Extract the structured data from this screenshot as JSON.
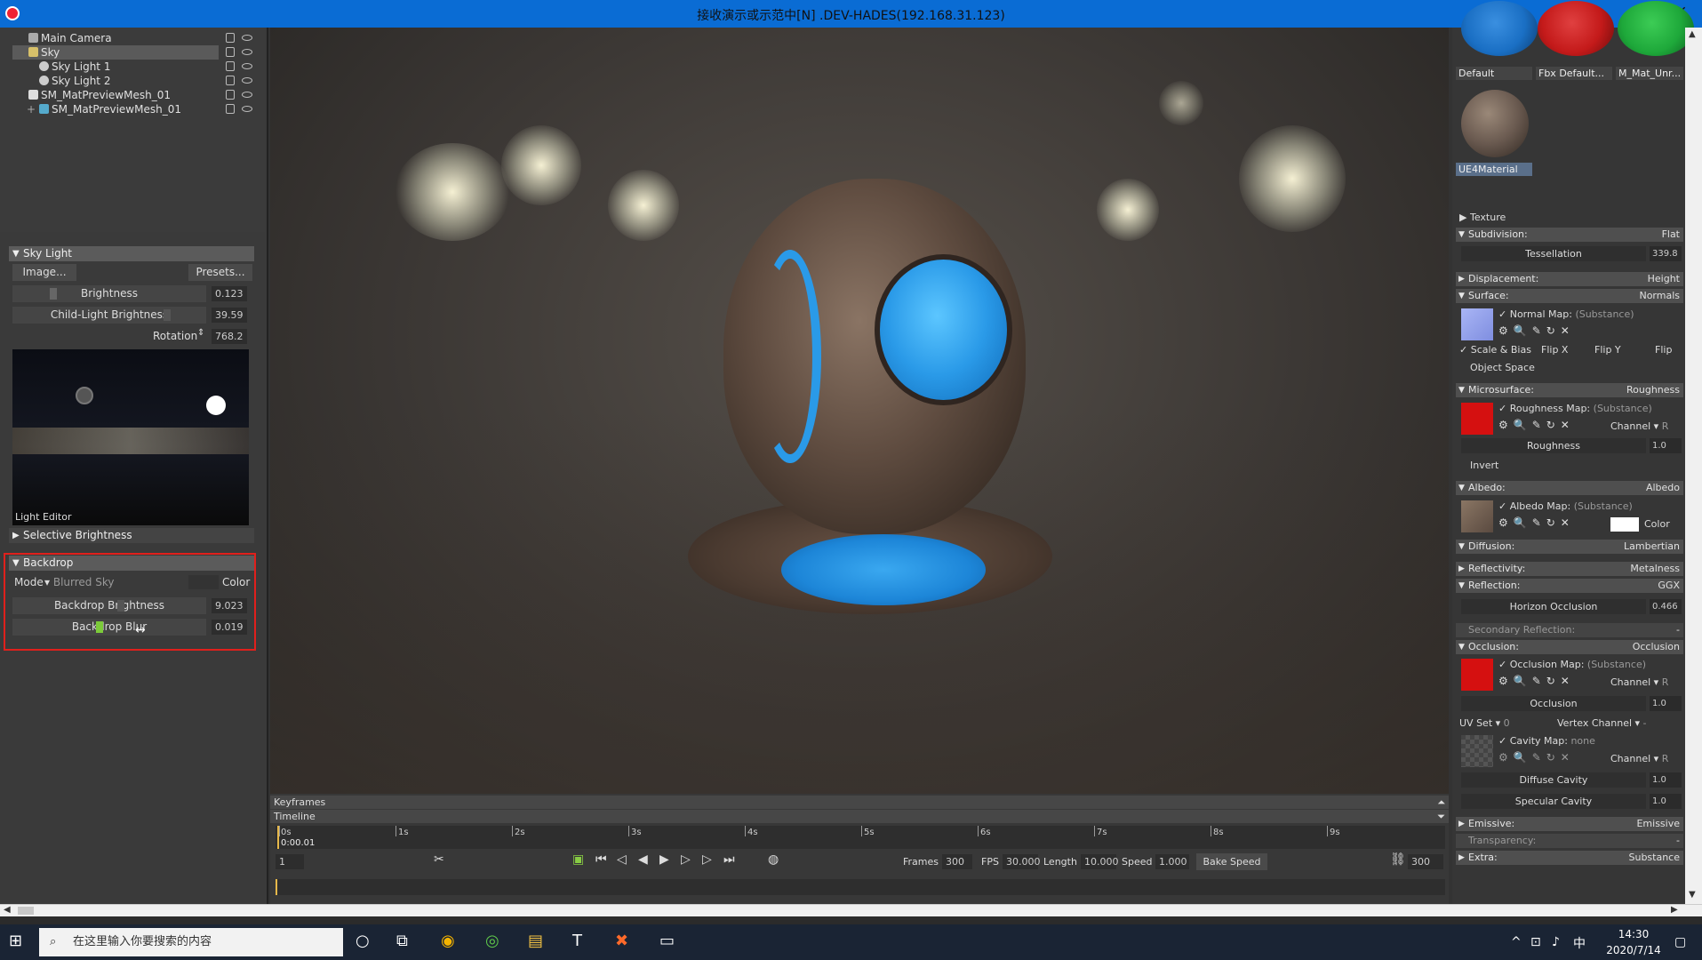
{
  "window": {
    "title": "接收演示或示范中[N] .DEV-HADES(192.168.31.123)",
    "minimize": "–",
    "maximize": "□",
    "close": "✕"
  },
  "scene_tree": {
    "items": [
      {
        "label": "Main Camera"
      },
      {
        "label": "Sky"
      },
      {
        "label": "Sky Light 1"
      },
      {
        "label": "Sky Light 2"
      },
      {
        "label": "SM_MatPreviewMesh_01"
      },
      {
        "label": "SM_MatPreviewMesh_01"
      }
    ]
  },
  "sky_light": {
    "header": "Sky Light",
    "image_button": "Image...",
    "presets_button": "Presets...",
    "brightness_label": "Brightness",
    "brightness_value": "0.123",
    "child_brightness_label": "Child-Light Brightness",
    "child_brightness_value": "39.59",
    "rotation_label": "Rotation",
    "rotation_value": "768.2",
    "light_editor_label": "Light Editor",
    "selective_brightness": "Selective Brightness"
  },
  "backdrop": {
    "header": "Backdrop",
    "mode_label": "Mode",
    "mode_value": "Blurred Sky",
    "color_label": "Color",
    "brightness_label": "Backdrop Brightness",
    "brightness_value": "9.023",
    "blur_label": "Backdrop Blur",
    "blur_value": "0.019",
    "highlight_color": "#e0201c"
  },
  "timeline": {
    "keyframes_label": "Keyframes",
    "timeline_label": "Timeline",
    "current_time": "0:00.01",
    "ticks": [
      "0s",
      "1s",
      "2s",
      "3s",
      "4s",
      "5s",
      "6s",
      "7s",
      "8s",
      "9s"
    ],
    "frame_field": "1",
    "frames_label": "Frames",
    "frames_value": "300",
    "fps_label": "FPS",
    "fps_value": "30.000",
    "length_label": "Length",
    "length_value": "10.000",
    "speed_label": "Speed",
    "speed_value": "1.000",
    "bake_speed": "Bake Speed",
    "end_value": "300"
  },
  "materials": {
    "items": [
      {
        "label": "Default",
        "color": "#1a6fc4"
      },
      {
        "label": "Fbx Default...",
        "color": "#c41a1a"
      },
      {
        "label": "M_Mat_Unr...",
        "color": "#1ea83a"
      },
      {
        "label": "UE4Material",
        "color": "#6a5a50"
      }
    ]
  },
  "material_props": {
    "texture": "Texture",
    "subdivision": "Subdivision:",
    "subdivision_mode": "Flat",
    "tessellation_label": "Tessellation",
    "tessellation_value": "339.8",
    "displacement": "Displacement:",
    "displacement_mode": "Height",
    "surface": "Surface:",
    "surface_mode": "Normals",
    "normal_map": "Normal Map:",
    "substance": "(Substance)",
    "scale_bias": "Scale & Bias",
    "flip_x": "Flip X",
    "flip_y": "Flip Y",
    "flip_z": "Flip",
    "object_space": "Object Space",
    "microsurface": "Microsurface:",
    "microsurface_mode": "Roughness",
    "roughness_map": "Roughness Map:",
    "channel_label": "Channel",
    "channel_value": "R",
    "roughness_label": "Roughness",
    "roughness_value": "1.0",
    "invert": "Invert",
    "albedo": "Albedo:",
    "albedo_mode": "Albedo",
    "albedo_map": "Albedo Map:",
    "color_label": "Color",
    "diffusion": "Diffusion:",
    "diffusion_mode": "Lambertian",
    "reflectivity": "Reflectivity:",
    "reflectivity_mode": "Metalness",
    "reflection": "Reflection:",
    "reflection_mode": "GGX",
    "horizon_label": "Horizon Occlusion",
    "horizon_value": "0.466",
    "secondary_reflection": "Secondary Reflection:",
    "secondary_mode": "-",
    "occlusion": "Occlusion:",
    "occlusion_mode": "Occlusion",
    "occlusion_map": "Occlusion Map:",
    "occlusion_label": "Occlusion",
    "occlusion_value": "1.0",
    "uvset_label": "UV Set",
    "uvset_value": "0",
    "vertex_channel": "Vertex Channel",
    "vertex_channel_value": "-",
    "cavity_map": "Cavity Map:",
    "cavity_none": "none",
    "diffuse_cavity": "Diffuse Cavity",
    "diffuse_cavity_value": "1.0",
    "specular_cavity": "Specular Cavity",
    "specular_cavity_value": "1.0",
    "emissive": "Emissive:",
    "emissive_mode": "Emissive",
    "transparency": "Transparency:",
    "transparency_mode": "-",
    "extra": "Extra:",
    "extra_mode": "Substance"
  },
  "taskbar": {
    "search_placeholder": "在这里输入你要搜索的内容",
    "time": "14:30",
    "date": "2020/7/14",
    "ime": "中"
  }
}
